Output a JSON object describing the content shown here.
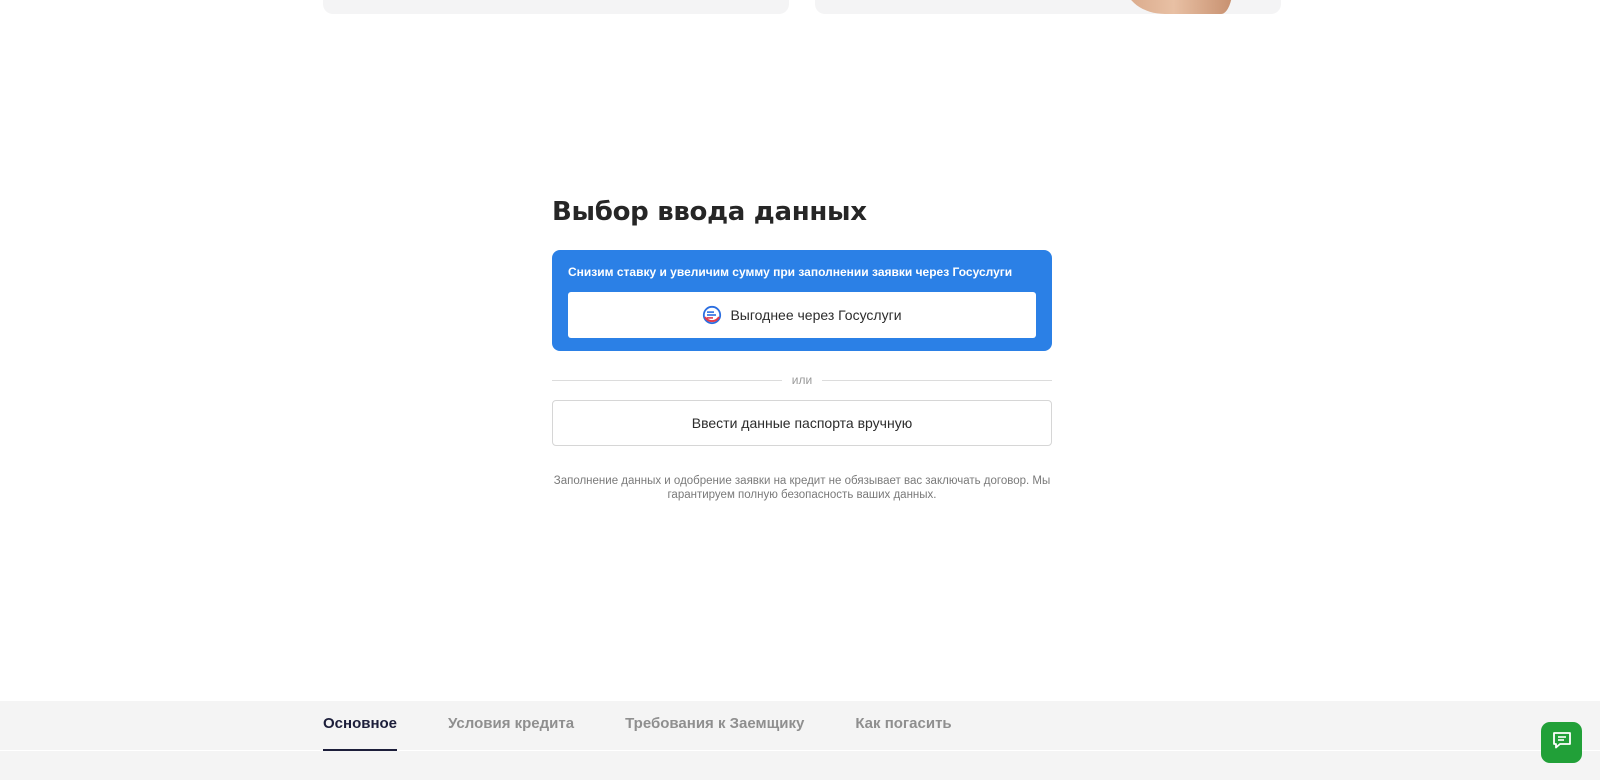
{
  "section": {
    "title": "Выбор ввода данных"
  },
  "promo": {
    "text": "Снизим ставку и увеличим сумму при заполнении заявки через Госуслуги",
    "button_label": "Выгоднее через Госуслуги",
    "icon": "gosuslugi-logo-icon",
    "background_color": "#2b80e6"
  },
  "divider": {
    "label": "или"
  },
  "manual": {
    "button_label": "Ввести данные паспорта вручную"
  },
  "disclaimer": {
    "text": "Заполнение данных и одобрение заявки на кредит не обязывает вас заключать договор. Мы гарантируем полную безопасность ваших данных."
  },
  "tabs": [
    {
      "label": "Основное",
      "active": true
    },
    {
      "label": "Условия кредита",
      "active": false
    },
    {
      "label": "Требования к Заемщику",
      "active": false
    },
    {
      "label": "Как погасить",
      "active": false
    }
  ],
  "chat": {
    "icon": "chat-icon",
    "color": "#21a038"
  }
}
